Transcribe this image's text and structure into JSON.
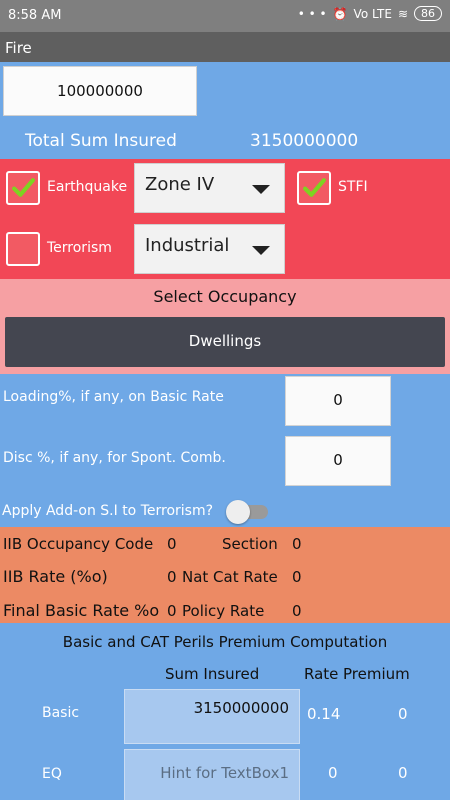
{
  "status": {
    "time": "8:58 AM",
    "lte": "Vo LTE",
    "battery": "86"
  },
  "title": "Fire",
  "sum_input_value": "100000000",
  "total": {
    "label": "Total Sum Insured",
    "value": "3150000000"
  },
  "perils": {
    "earthquake": {
      "label": "Earthquake",
      "checked": true,
      "zone": "Zone IV"
    },
    "stfi": {
      "label": "STFI",
      "checked": true
    },
    "terrorism": {
      "label": "Terrorism",
      "checked": false,
      "type": "Industrial"
    }
  },
  "occupancy": {
    "title": "Select Occupancy",
    "selected": "Dwellings"
  },
  "loading": {
    "label": "Loading%, if any, on Basic Rate",
    "value": "0"
  },
  "disc": {
    "label": "Disc %, if any, for Spont. Comb.",
    "value": "0"
  },
  "addon": {
    "label": "Apply Add-on S.I to Terrorism?",
    "on": false
  },
  "rates": {
    "iib_code_label": "IIB Occupancy Code",
    "iib_code_value": "0",
    "section_label": "Section",
    "section_value": "0",
    "iib_rate_label": "IIB  Rate (%o)",
    "iib_rate_value": "0",
    "nat_cat_label": "Nat Cat Rate",
    "nat_cat_value": "0",
    "final_label": "Final Basic Rate %o",
    "final_value": "0",
    "policy_label": "Policy Rate",
    "policy_value": "0"
  },
  "computation": {
    "title": "Basic and CAT Perils Premium Computation",
    "col_sum": "Sum Insured",
    "col_rate": "Rate",
    "col_premium": "Premium",
    "rows": [
      {
        "label": "Basic",
        "sum": "3150000000",
        "rate": "0.14",
        "premium": "0"
      },
      {
        "label": "EQ",
        "sum_hint": "Hint for TextBox1",
        "rate": "0",
        "premium": "0"
      }
    ]
  }
}
